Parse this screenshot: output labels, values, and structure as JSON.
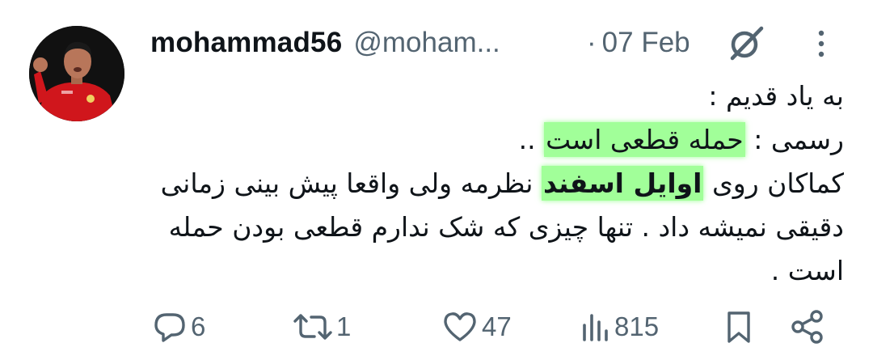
{
  "author": {
    "display_name": "mohammad56",
    "handle": "@moham...",
    "date_separator": "·",
    "date": "07 Feb"
  },
  "tweet": {
    "line1": "به یاد قدیم :",
    "line2_prefix": "رسمی : ",
    "line2_highlight": "حمله قطعی است",
    "line2_suffix": " ..",
    "line3_a": "کماکان روی ",
    "line3_bold": "اوایل اسفند",
    "line3_b": " نظرمه ولی واقعا پیش بینی زمانی",
    "line4": "دقیقی نمیشه داد . تنها چیزی که شک ندارم قطعی بودن حمله",
    "line5": "است ."
  },
  "actions": {
    "replies": "6",
    "reposts": "1",
    "likes": "47",
    "views": "815"
  },
  "icons": {
    "reply": "reply-icon",
    "repost": "repost-icon",
    "like": "like-icon",
    "views": "views-icon",
    "bookmark": "bookmark-icon",
    "share": "share-icon",
    "grok": "grok-icon",
    "more": "more-icon"
  },
  "colors": {
    "text": "#0f1419",
    "secondary": "#536471",
    "highlight": "#53ff45"
  }
}
